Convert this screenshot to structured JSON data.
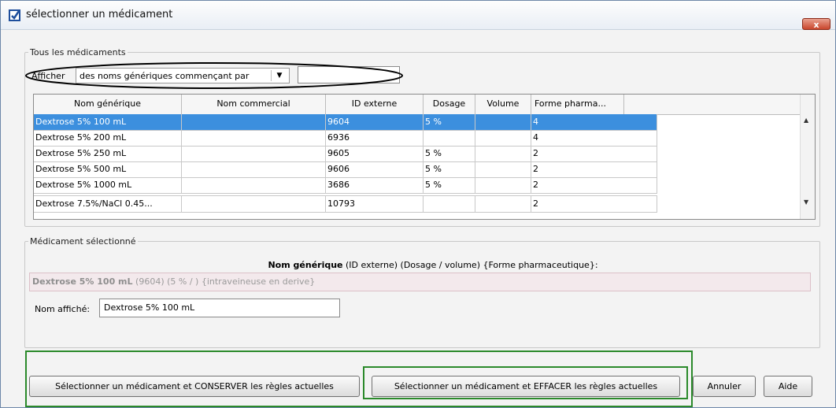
{
  "window": {
    "title": "sélectionner un médicament",
    "close_label": "x"
  },
  "group_all": {
    "legend": "Tous les médicaments",
    "afficher_label": "Afficher",
    "select_value": "des noms génériques commençant par",
    "filter_value": ""
  },
  "table": {
    "columns": [
      "Nom générique",
      "Nom commercial",
      "ID externe",
      "Dosage",
      "Volume",
      "Forme pharma..."
    ],
    "rows": [
      {
        "nom": "Dextrose  5%   100 mL",
        "commercial": "",
        "id": "9604",
        "dosage": "5 %",
        "volume": "",
        "forme": "4"
      },
      {
        "nom": "Dextrose  5%   200 mL",
        "commercial": "",
        "id": "6936",
        "dosage": "",
        "volume": "",
        "forme": "4"
      },
      {
        "nom": "Dextrose  5%   250 mL",
        "commercial": "",
        "id": "9605",
        "dosage": "5 %",
        "volume": "",
        "forme": "2"
      },
      {
        "nom": "Dextrose  5%   500 mL",
        "commercial": "",
        "id": "9606",
        "dosage": "5 %",
        "volume": "",
        "forme": "2"
      },
      {
        "nom": "Dextrose  5%   1000 mL",
        "commercial": "",
        "id": "3686",
        "dosage": "5 %",
        "volume": "",
        "forme": "2"
      },
      {
        "nom": "Dextrose  7.5%/NaCl 0.45...",
        "commercial": "",
        "id": "10793",
        "dosage": "",
        "volume": "",
        "forme": "2"
      }
    ],
    "selected_index": 0
  },
  "group_selected": {
    "legend": "Médicament sélectionné",
    "header_bold": "Nom générique",
    "header_rest": " (ID externe) (Dosage / volume) {Forme pharmaceutique}:",
    "selected_bold": "Dextrose 5% 100 mL",
    "selected_rest": " (9604) (5 % / ) {intraveineuse en derive}",
    "nom_affiche_label": "Nom affiché:",
    "nom_affiche_value": "Dextrose  5%   100 mL"
  },
  "buttons": {
    "keep": "Sélectionner un médicament et CONSERVER les règles actuelles",
    "clear": "Sélectionner un médicament et EFFACER les règles actuelles",
    "cancel": "Annuler",
    "help": "Aide"
  },
  "colors": {
    "selection": "#3c8fde",
    "annotation_ellipse": "#000000",
    "annotation_box": "#2b8a2b",
    "close": "#c9462c"
  }
}
